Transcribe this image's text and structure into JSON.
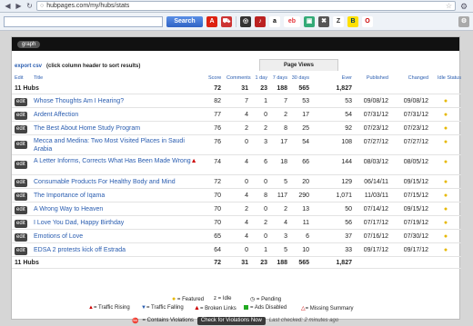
{
  "browser": {
    "url": "hubpages.com/my/hubs/stats"
  },
  "toolbar": {
    "search_label": "Search",
    "icons": [
      "ask-icon",
      "cart-icon",
      "compass-icon",
      "itunes-icon",
      "amazon-icon",
      "ebay-icon",
      "shop-icon",
      "tools-icon",
      "z-icon",
      "bestbuy-icon",
      "opera-icon"
    ]
  },
  "graph_btn": "graph",
  "export_csv": "export csv",
  "csv_note": "(click column header to sort results)",
  "page_views_tab": "Page Views",
  "headers": {
    "edit": "Edit",
    "title": "Title",
    "score": "Score",
    "comments": "Comments",
    "day1": "1 day",
    "day7": "7 days",
    "day30": "30 days",
    "year": "Year",
    "ever": "Ever",
    "published": "Published",
    "changed": "Changed",
    "status": "Idle Status"
  },
  "summary": {
    "label": "11 Hubs",
    "score": "72",
    "comments": "31",
    "day1": "23",
    "day7": "188",
    "day30": "565",
    "ever": "1,827"
  },
  "rows": [
    {
      "edit": "edit",
      "title": "Whose Thoughts Am I Hearing?",
      "score": "82",
      "comments": "7",
      "day1": "1",
      "day7": "7",
      "day30": "53",
      "year": "53",
      "published": "09/08/12",
      "changed": "09/08/12"
    },
    {
      "edit": "edit",
      "title": "Ardent Affection",
      "score": "77",
      "comments": "4",
      "day1": "0",
      "day7": "2",
      "day30": "17",
      "year": "54",
      "published": "07/31/12",
      "changed": "07/31/12"
    },
    {
      "edit": "edit",
      "title": "The Best About Home Study Program",
      "score": "76",
      "comments": "2",
      "day1": "2",
      "day7": "8",
      "day30": "25",
      "year": "92",
      "published": "07/23/12",
      "changed": "07/23/12"
    },
    {
      "edit": "edit",
      "title": "Mecca and Medina: Two Most Visited Places in Saudi Arabia",
      "score": "76",
      "comments": "0",
      "day1": "3",
      "day7": "17",
      "day30": "54",
      "year": "108",
      "published": "07/27/12",
      "changed": "07/27/12"
    },
    {
      "edit": "edit",
      "title": "A Letter Informs, Corrects What Has Been Made Wrong",
      "score": "74",
      "comments": "4",
      "day1": "6",
      "day7": "18",
      "day30": "66",
      "year": "144",
      "published": "08/03/12",
      "changed": "08/05/12"
    },
    {
      "edit": "edit",
      "title": "Consumable Products For Healthy Body and Mind",
      "score": "72",
      "comments": "0",
      "day1": "0",
      "day7": "5",
      "day30": "20",
      "year": "129",
      "published": "06/14/11",
      "changed": "09/15/12"
    },
    {
      "edit": "edit",
      "title": "The Importance of Iqama",
      "score": "70",
      "comments": "4",
      "day1": "8",
      "day7": "117",
      "day30": "290",
      "year": "1,071",
      "published": "11/03/11",
      "changed": "07/15/12"
    },
    {
      "edit": "edit",
      "title": "A Wrong Way to Heaven",
      "score": "70",
      "comments": "2",
      "day1": "0",
      "day7": "2",
      "day30": "13",
      "year": "50",
      "published": "07/14/12",
      "changed": "09/15/12"
    },
    {
      "edit": "edit",
      "title": "I Love You Dad, Happy Birthday",
      "score": "70",
      "comments": "4",
      "day1": "2",
      "day7": "4",
      "day30": "11",
      "year": "56",
      "published": "07/17/12",
      "changed": "07/19/12"
    },
    {
      "edit": "edit",
      "title": "Emotions of Love",
      "score": "65",
      "comments": "4",
      "day1": "0",
      "day7": "3",
      "day30": "6",
      "year": "37",
      "published": "07/16/12",
      "changed": "07/30/12"
    },
    {
      "edit": "edit",
      "title": "EDSA 2 protests kick off Estrada",
      "score": "64",
      "comments": "0",
      "day1": "1",
      "day7": "5",
      "day30": "10",
      "year": "33",
      "published": "09/17/12",
      "changed": "09/17/12"
    }
  ],
  "legend": {
    "featured": "= Featured",
    "idle": "= Idle",
    "pending": "= Pending",
    "rising": "= Traffic Rising",
    "falling": "= Traffic Falling",
    "broken": "= Broken Links",
    "ads_disabled": "= Ads Disabled",
    "missing": "= Missing Summary"
  },
  "footer": {
    "violations": "= Contains Violations",
    "check_btn": "Check for Violations Now",
    "last_checked": "Last checked: 2 minutes ago"
  },
  "colors": {
    "link": "#2a5db0",
    "featured": "#e6b800",
    "warning": "#cc0000"
  }
}
